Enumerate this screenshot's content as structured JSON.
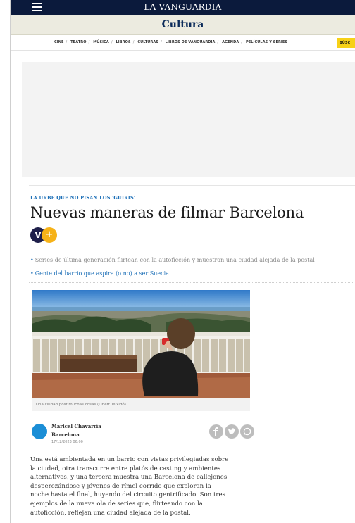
{
  "header": {
    "logo": "LA VANGUARDIA",
    "section": "Cultura",
    "nav": [
      "CINE",
      "TEATRO",
      "MÚSICA",
      "LIBROS",
      "CULTURAS",
      "LIBROS DE VANGUARDIA",
      "AGENDA",
      "PELÍCULAS Y SERIES"
    ],
    "badge": "BÚSC"
  },
  "article": {
    "kicker": "LA URBE QUE NO PISAN LOS 'GUIRIS'",
    "headline": "Nuevas maneras de filmar Barcelona",
    "badge_v": "V",
    "badge_plus": "+",
    "related": [
      "Series de última generación flirtean con la autoficción y muestran una ciudad alejada de la postal",
      "Gente del barrio que aspira (o no) a ser Suecia"
    ],
    "caption": "Una ciudad post muchas cosas (Libert Teixidó)",
    "author": {
      "name": "Maricel Chavarría",
      "city": "Barcelona",
      "date": "17/12/2023 06:00"
    },
    "body_lines": [
      "Una está ambientada en un barrio con vistas privilegiadas sobre",
      "la ciudad, otra transcurre entre platós de casting y ambientes",
      "alternativos, y una tercera muestra una Barcelona de callejones",
      "desperezándose y jóvenes de rímel corrido que exploran la",
      "noche hasta el final, huyendo del circuito gentrificado. Son tres",
      "ejemplos de la nueva ola de series que, flirteando con la",
      "autoficción, reflejan una ciudad alejada de la postal."
    ]
  },
  "colors": {
    "topbar": "#0b1a3c",
    "section_bg": "#ecebe0",
    "accent_blue": "#1c6fb7",
    "badge_yellow": "#f7d117",
    "vplus_yellow": "#f6b218"
  }
}
